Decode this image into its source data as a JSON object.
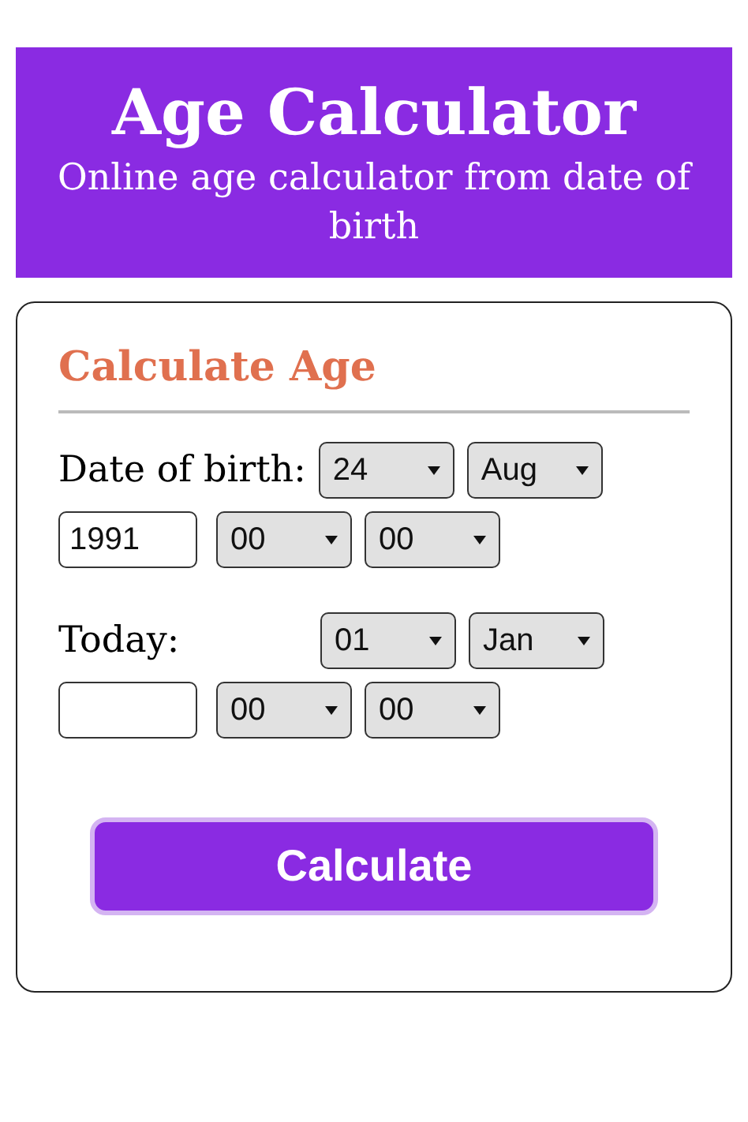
{
  "header": {
    "title": "Age Calculator",
    "subtitle": "Online age calculator from date of birth"
  },
  "form": {
    "heading": "Calculate Age",
    "sections": [
      {
        "label": "Date of birth:",
        "day": "24",
        "month": "Aug",
        "year": "1991",
        "hour": "00",
        "minute": "00"
      },
      {
        "label": "Today:",
        "day": "01",
        "month": "Jan",
        "hour": "00",
        "minute": "00"
      }
    ]
  },
  "button": {
    "label": "Calculate"
  }
}
